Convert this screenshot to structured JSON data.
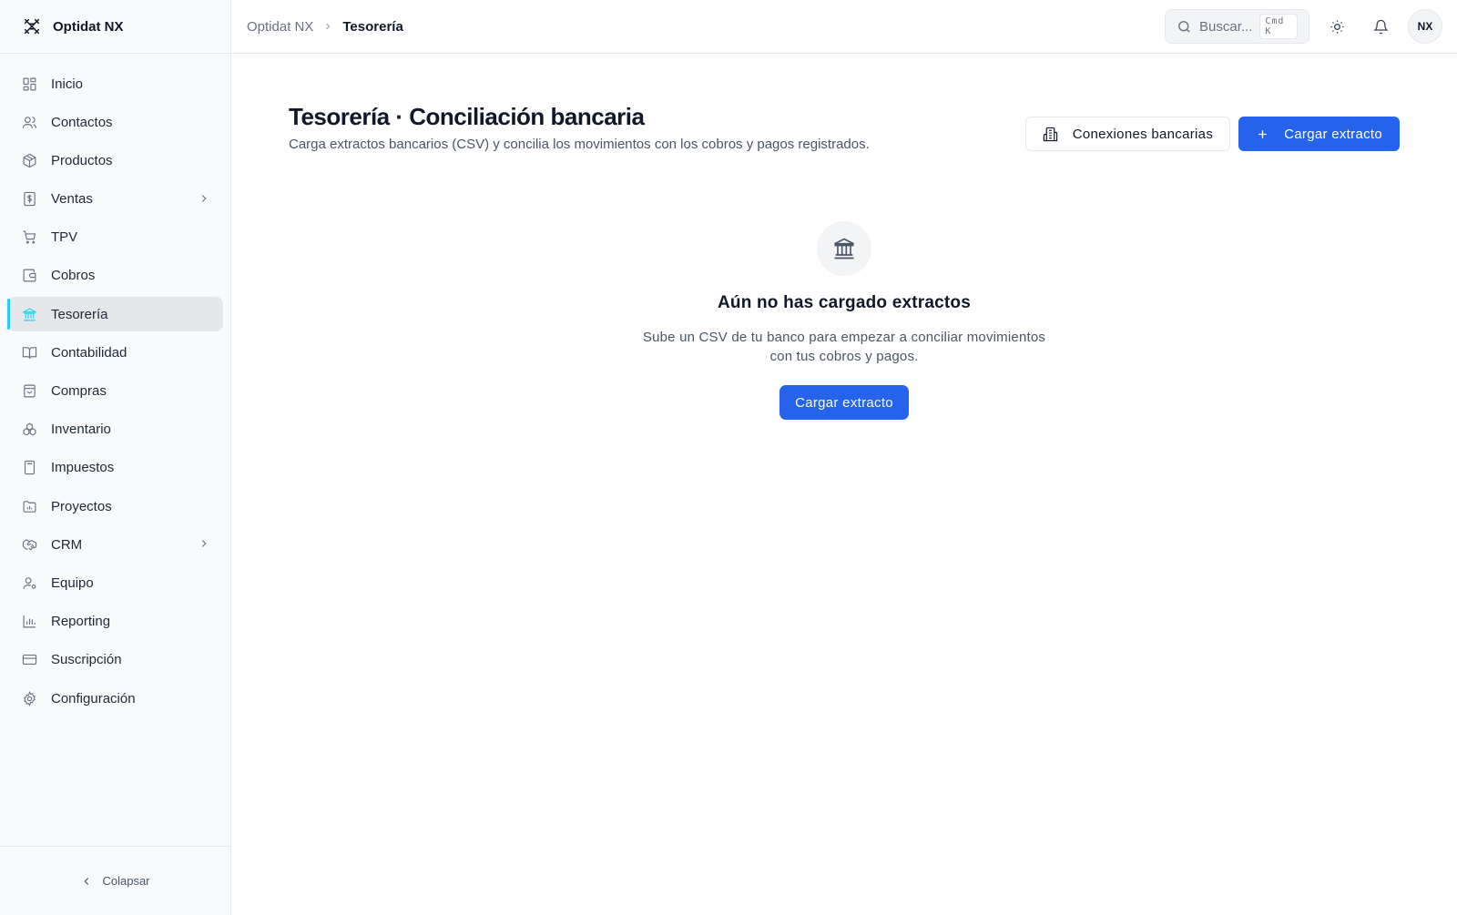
{
  "app": {
    "name": "Optidat NX"
  },
  "sidebar": {
    "items": [
      {
        "label": "Inicio",
        "icon": "dashboard-icon"
      },
      {
        "label": "Contactos",
        "icon": "users-icon"
      },
      {
        "label": "Productos",
        "icon": "package-icon"
      },
      {
        "label": "Ventas",
        "icon": "receipt-dollar-icon",
        "expandable": true
      },
      {
        "label": "TPV",
        "icon": "cart-icon"
      },
      {
        "label": "Cobros",
        "icon": "wallet-icon"
      },
      {
        "label": "Tesorería",
        "icon": "bank-icon",
        "active": true
      },
      {
        "label": "Contabilidad",
        "icon": "book-icon"
      },
      {
        "label": "Compras",
        "icon": "shopping-bag-icon"
      },
      {
        "label": "Inventario",
        "icon": "boxes-icon"
      },
      {
        "label": "Impuestos",
        "icon": "calculator-icon"
      },
      {
        "label": "Proyectos",
        "icon": "folder-chart-icon"
      },
      {
        "label": "CRM",
        "icon": "handshake-icon",
        "expandable": true
      },
      {
        "label": "Equipo",
        "icon": "user-gear-icon"
      },
      {
        "label": "Reporting",
        "icon": "bar-chart-icon"
      },
      {
        "label": "Suscripción",
        "icon": "credit-card-icon"
      },
      {
        "label": "Configuración",
        "icon": "gear-icon"
      }
    ],
    "collapse_label": "Colapsar"
  },
  "topbar": {
    "breadcrumb": {
      "root": "Optidat NX",
      "current": "Tesorería"
    },
    "search_placeholder": "Buscar...",
    "shortcut": "Cmd K",
    "avatar_initials": "NX"
  },
  "page": {
    "title": "Tesorería · Conciliación bancaria",
    "subtitle": "Carga extractos bancarios (CSV) y concilia los movimientos con los cobros y pagos registrados.",
    "actions": {
      "connections_label": "Conexiones bancarias",
      "upload_label": "Cargar extracto"
    }
  },
  "empty_state": {
    "title": "Aún no has cargado extractos",
    "text": "Sube un CSV de tu banco para empezar a conciliar movimientos con tus cobros y pagos.",
    "button_label": "Cargar extracto"
  },
  "colors": {
    "primary": "#2563eb",
    "active_accent": "#22d3ee"
  }
}
